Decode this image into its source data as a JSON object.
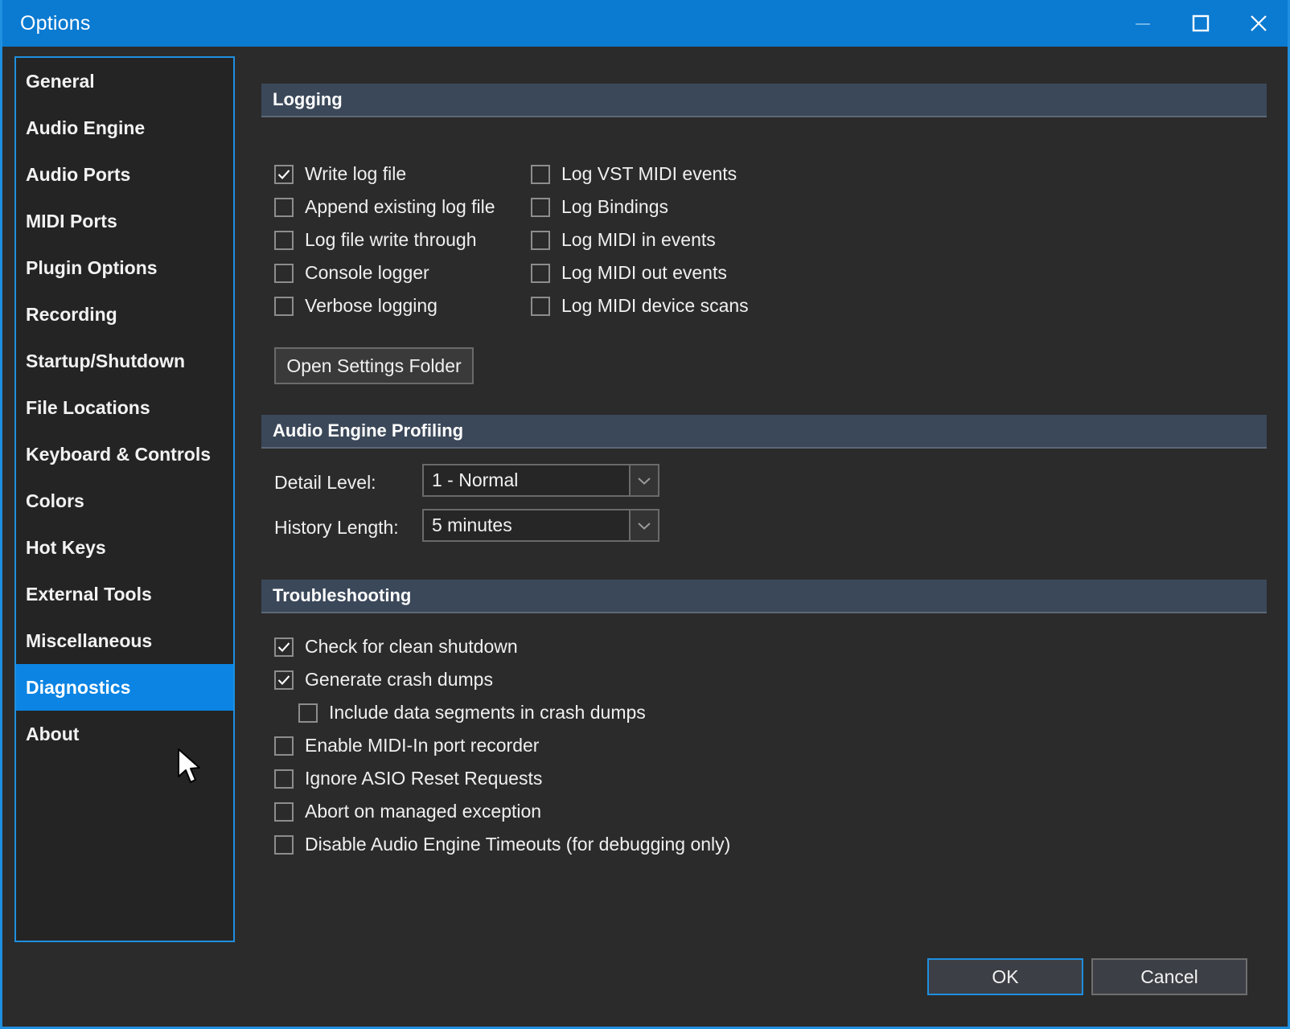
{
  "window": {
    "title": "Options",
    "accent_color": "#0b7ad1",
    "border_color": "#1f8fe0",
    "background_color": "#2b2b2b",
    "controls": {
      "minimize": "minimize",
      "maximize": "maximize",
      "close": "close"
    }
  },
  "sidebar": {
    "selected": "Diagnostics",
    "items": [
      {
        "label": "General"
      },
      {
        "label": "Audio Engine"
      },
      {
        "label": "Audio Ports"
      },
      {
        "label": "MIDI Ports"
      },
      {
        "label": "Plugin Options"
      },
      {
        "label": "Recording"
      },
      {
        "label": "Startup/Shutdown"
      },
      {
        "label": "File Locations"
      },
      {
        "label": "Keyboard & Controls"
      },
      {
        "label": "Colors"
      },
      {
        "label": "Hot Keys"
      },
      {
        "label": "External Tools"
      },
      {
        "label": "Miscellaneous"
      },
      {
        "label": "Diagnostics"
      },
      {
        "label": "About"
      }
    ]
  },
  "logging": {
    "title": "Logging",
    "left_column": [
      {
        "label": "Write log file",
        "checked": true
      },
      {
        "label": "Append existing log file",
        "checked": false
      },
      {
        "label": "Log file write through",
        "checked": false
      },
      {
        "label": "Console logger",
        "checked": false
      },
      {
        "label": "Verbose logging",
        "checked": false
      }
    ],
    "right_column": [
      {
        "label": "Log VST MIDI events",
        "checked": false
      },
      {
        "label": "Log Bindings",
        "checked": false
      },
      {
        "label": "Log MIDI in events",
        "checked": false
      },
      {
        "label": "Log MIDI out events",
        "checked": false
      },
      {
        "label": "Log MIDI device scans",
        "checked": false
      }
    ],
    "open_settings_folder_label": "Open Settings Folder"
  },
  "profiling": {
    "title": "Audio Engine Profiling",
    "detail_level": {
      "label": "Detail Level:",
      "value": "1 - Normal"
    },
    "history_length": {
      "label": "History Length:",
      "value": "5 minutes"
    }
  },
  "troubleshooting": {
    "title": "Troubleshooting",
    "items": [
      {
        "label": "Check for clean shutdown",
        "checked": true,
        "indent": false
      },
      {
        "label": "Generate crash dumps",
        "checked": true,
        "indent": false
      },
      {
        "label": "Include data segments in crash dumps",
        "checked": false,
        "indent": true
      },
      {
        "label": "Enable MIDI-In port recorder",
        "checked": false,
        "indent": false
      },
      {
        "label": "Ignore ASIO Reset Requests",
        "checked": false,
        "indent": false
      },
      {
        "label": "Abort on managed exception",
        "checked": false,
        "indent": false
      },
      {
        "label": "Disable Audio Engine Timeouts (for debugging only)",
        "checked": false,
        "indent": false
      }
    ]
  },
  "footer": {
    "ok_label": "OK",
    "cancel_label": "Cancel"
  }
}
